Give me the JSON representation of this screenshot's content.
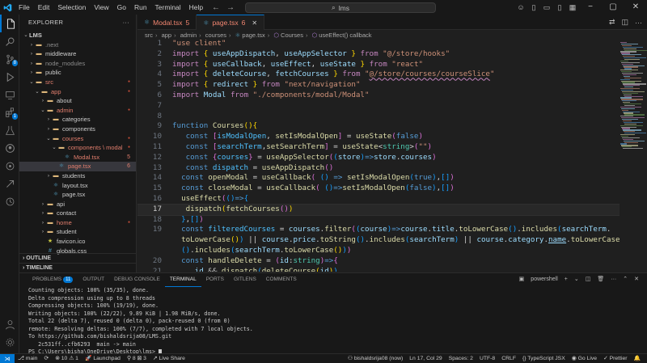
{
  "titlebar": {
    "menu": [
      "File",
      "Edit",
      "Selection",
      "View",
      "Go",
      "Run",
      "Terminal",
      "Help"
    ],
    "search": "lms"
  },
  "activity": {
    "source_control_badge": "8",
    "extensions_badge": "1"
  },
  "explorer": {
    "title": "EXPLORER",
    "root": "LMS",
    "items": [
      {
        "label": ".next",
        "depth": 1,
        "type": "folder",
        "open": false,
        "color": "#8b8b8b"
      },
      {
        "label": "middleware",
        "depth": 1,
        "type": "folder",
        "open": false,
        "color": "#cccccc"
      },
      {
        "label": "node_modules",
        "depth": 1,
        "type": "folder",
        "open": false,
        "color": "#8b8b8b"
      },
      {
        "label": "public",
        "depth": 1,
        "type": "folder",
        "open": false,
        "color": "#cccccc"
      },
      {
        "label": "src",
        "depth": 1,
        "type": "folder",
        "open": true,
        "color": "#e27e6d",
        "dot": true
      },
      {
        "label": "app",
        "depth": 2,
        "type": "folder",
        "open": true,
        "color": "#e27e6d",
        "dot": true
      },
      {
        "label": "about",
        "depth": 3,
        "type": "folder",
        "open": false,
        "color": "#cccccc"
      },
      {
        "label": "admin",
        "depth": 3,
        "type": "folder",
        "open": true,
        "color": "#e27e6d",
        "dot": true
      },
      {
        "label": "categories",
        "depth": 4,
        "type": "folder",
        "open": false,
        "color": "#cccccc"
      },
      {
        "label": "components",
        "depth": 4,
        "type": "folder",
        "open": false,
        "color": "#cccccc"
      },
      {
        "label": "courses",
        "depth": 4,
        "type": "folder",
        "open": true,
        "color": "#e27e6d",
        "dot": true
      },
      {
        "label": "components \\ modal",
        "depth": 5,
        "type": "folder",
        "open": true,
        "color": "#e27e6d",
        "dot": true
      },
      {
        "label": "Modal.tsx",
        "depth": 6,
        "type": "react",
        "color": "#e27e6d",
        "count": "5"
      },
      {
        "label": "page.tsx",
        "depth": 5,
        "type": "react",
        "color": "#e27e6d",
        "count": "6",
        "selected": true
      },
      {
        "label": "students",
        "depth": 4,
        "type": "folder",
        "open": false,
        "color": "#cccccc"
      },
      {
        "label": "layout.tsx",
        "depth": 4,
        "type": "react",
        "color": "#cccccc"
      },
      {
        "label": "page.tsx",
        "depth": 4,
        "type": "react",
        "color": "#cccccc"
      },
      {
        "label": "api",
        "depth": 3,
        "type": "folder",
        "open": false,
        "color": "#cccccc"
      },
      {
        "label": "contact",
        "depth": 3,
        "type": "folder",
        "open": false,
        "color": "#cccccc"
      },
      {
        "label": "home",
        "depth": 3,
        "type": "folder",
        "open": false,
        "color": "#e27e6d",
        "dot": true
      },
      {
        "label": "student",
        "depth": 3,
        "type": "folder",
        "open": false,
        "color": "#cccccc"
      },
      {
        "label": "favicon.ico",
        "depth": 3,
        "type": "star",
        "color": "#cccccc"
      },
      {
        "label": "globals.css",
        "depth": 3,
        "type": "css",
        "color": "#cccccc"
      }
    ],
    "outline": "OUTLINE",
    "timeline": "TIMELINE"
  },
  "tabs": [
    {
      "label": "Modal.tsx",
      "count": "5",
      "active": false
    },
    {
      "label": "page.tsx",
      "count": "6",
      "active": true
    }
  ],
  "breadcrumb": [
    "src",
    "app",
    "admin",
    "courses",
    "page.tsx",
    "Courses",
    "useEffect() callback"
  ],
  "editor": {
    "current_line": "17"
  },
  "panel": {
    "tabs": [
      {
        "label": "PROBLEMS",
        "badge": "11"
      },
      {
        "label": "OUTPUT"
      },
      {
        "label": "DEBUG CONSOLE"
      },
      {
        "label": "TERMINAL",
        "active": true
      },
      {
        "label": "PORTS"
      },
      {
        "label": "GITLENS"
      },
      {
        "label": "COMMENTS"
      }
    ],
    "shell": "powershell",
    "terminal_lines": [
      "Counting objects: 100% (35/35), done.",
      "Delta compression using up to 8 threads",
      "Compressing objects: 100% (19/19), done.",
      "Writing objects: 100% (22/22), 9.89 KiB | 1.98 MiB/s, done.",
      "Total 22 (delta 7), reused 0 (delta 0), pack-reused 0 (from 0)",
      "remote: Resolving deltas: 100% (7/7), completed with 7 local objects.",
      "To https://github.com/bishaldsrija08/LMS.git",
      "   2c531ff..cfb6293  main -> main"
    ],
    "prompt": "PS C:\\Users\\bisha\\OneDrive\\Desktop\\lms> "
  },
  "statusbar": {
    "branch": "main",
    "sync": "⟳",
    "problems": "⊗ 10  ⚠ 1",
    "launchpad": "Launchpad",
    "ports": "⚲ 8  ⊠ 3",
    "liveshare": "Live Share",
    "author": "bishaldsrija08 (now)",
    "position": "Ln 17, Col 29",
    "spaces": "Spaces: 2",
    "encoding": "UTF-8",
    "eol": "CRLF",
    "language": "TypeScript JSX",
    "golive": "Go Live",
    "prettier": "Prettier"
  }
}
